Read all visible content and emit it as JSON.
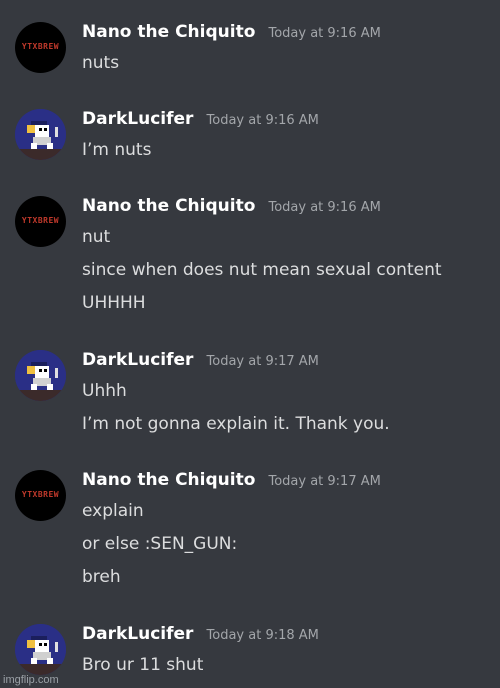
{
  "messages": [
    {
      "author": "Nano the Chiquito",
      "time": "Today at 9:16 AM",
      "avatar": "yt-red-logo",
      "avatar_text": "YTXBREW",
      "lines": [
        "nuts"
      ]
    },
    {
      "author": "DarkLucifer",
      "time": "Today at 9:16 AM",
      "avatar": "pixel-sprite",
      "lines": [
        "I’m nuts"
      ]
    },
    {
      "author": "Nano the Chiquito",
      "time": "Today at 9:16 AM",
      "avatar": "yt-red-logo",
      "avatar_text": "YTXBREW",
      "lines": [
        "nut",
        "since when does nut mean sexual content",
        "UHHHH"
      ]
    },
    {
      "author": "DarkLucifer",
      "time": "Today at 9:17 AM",
      "avatar": "pixel-sprite",
      "lines": [
        "Uhhh",
        "I’m not gonna explain it. Thank you."
      ]
    },
    {
      "author": "Nano the Chiquito",
      "time": "Today at 9:17 AM",
      "avatar": "yt-red-logo",
      "avatar_text": "YTXBREW",
      "lines": [
        "explain",
        "or else :SEN_GUN:",
        "breh"
      ]
    },
    {
      "author": "DarkLucifer",
      "time": "Today at 9:18 AM",
      "avatar": "pixel-sprite",
      "lines": [
        "Bro ur 11 shut"
      ]
    }
  ],
  "watermark": "imgflip.com",
  "colors": {
    "background": "#36393f",
    "username": "#ffffff",
    "timestamp": "#a3a6aa",
    "message_text": "#dcddde",
    "avatar_red_text": "#c0392b",
    "avatar_blue_bg": "#2a2f86"
  }
}
